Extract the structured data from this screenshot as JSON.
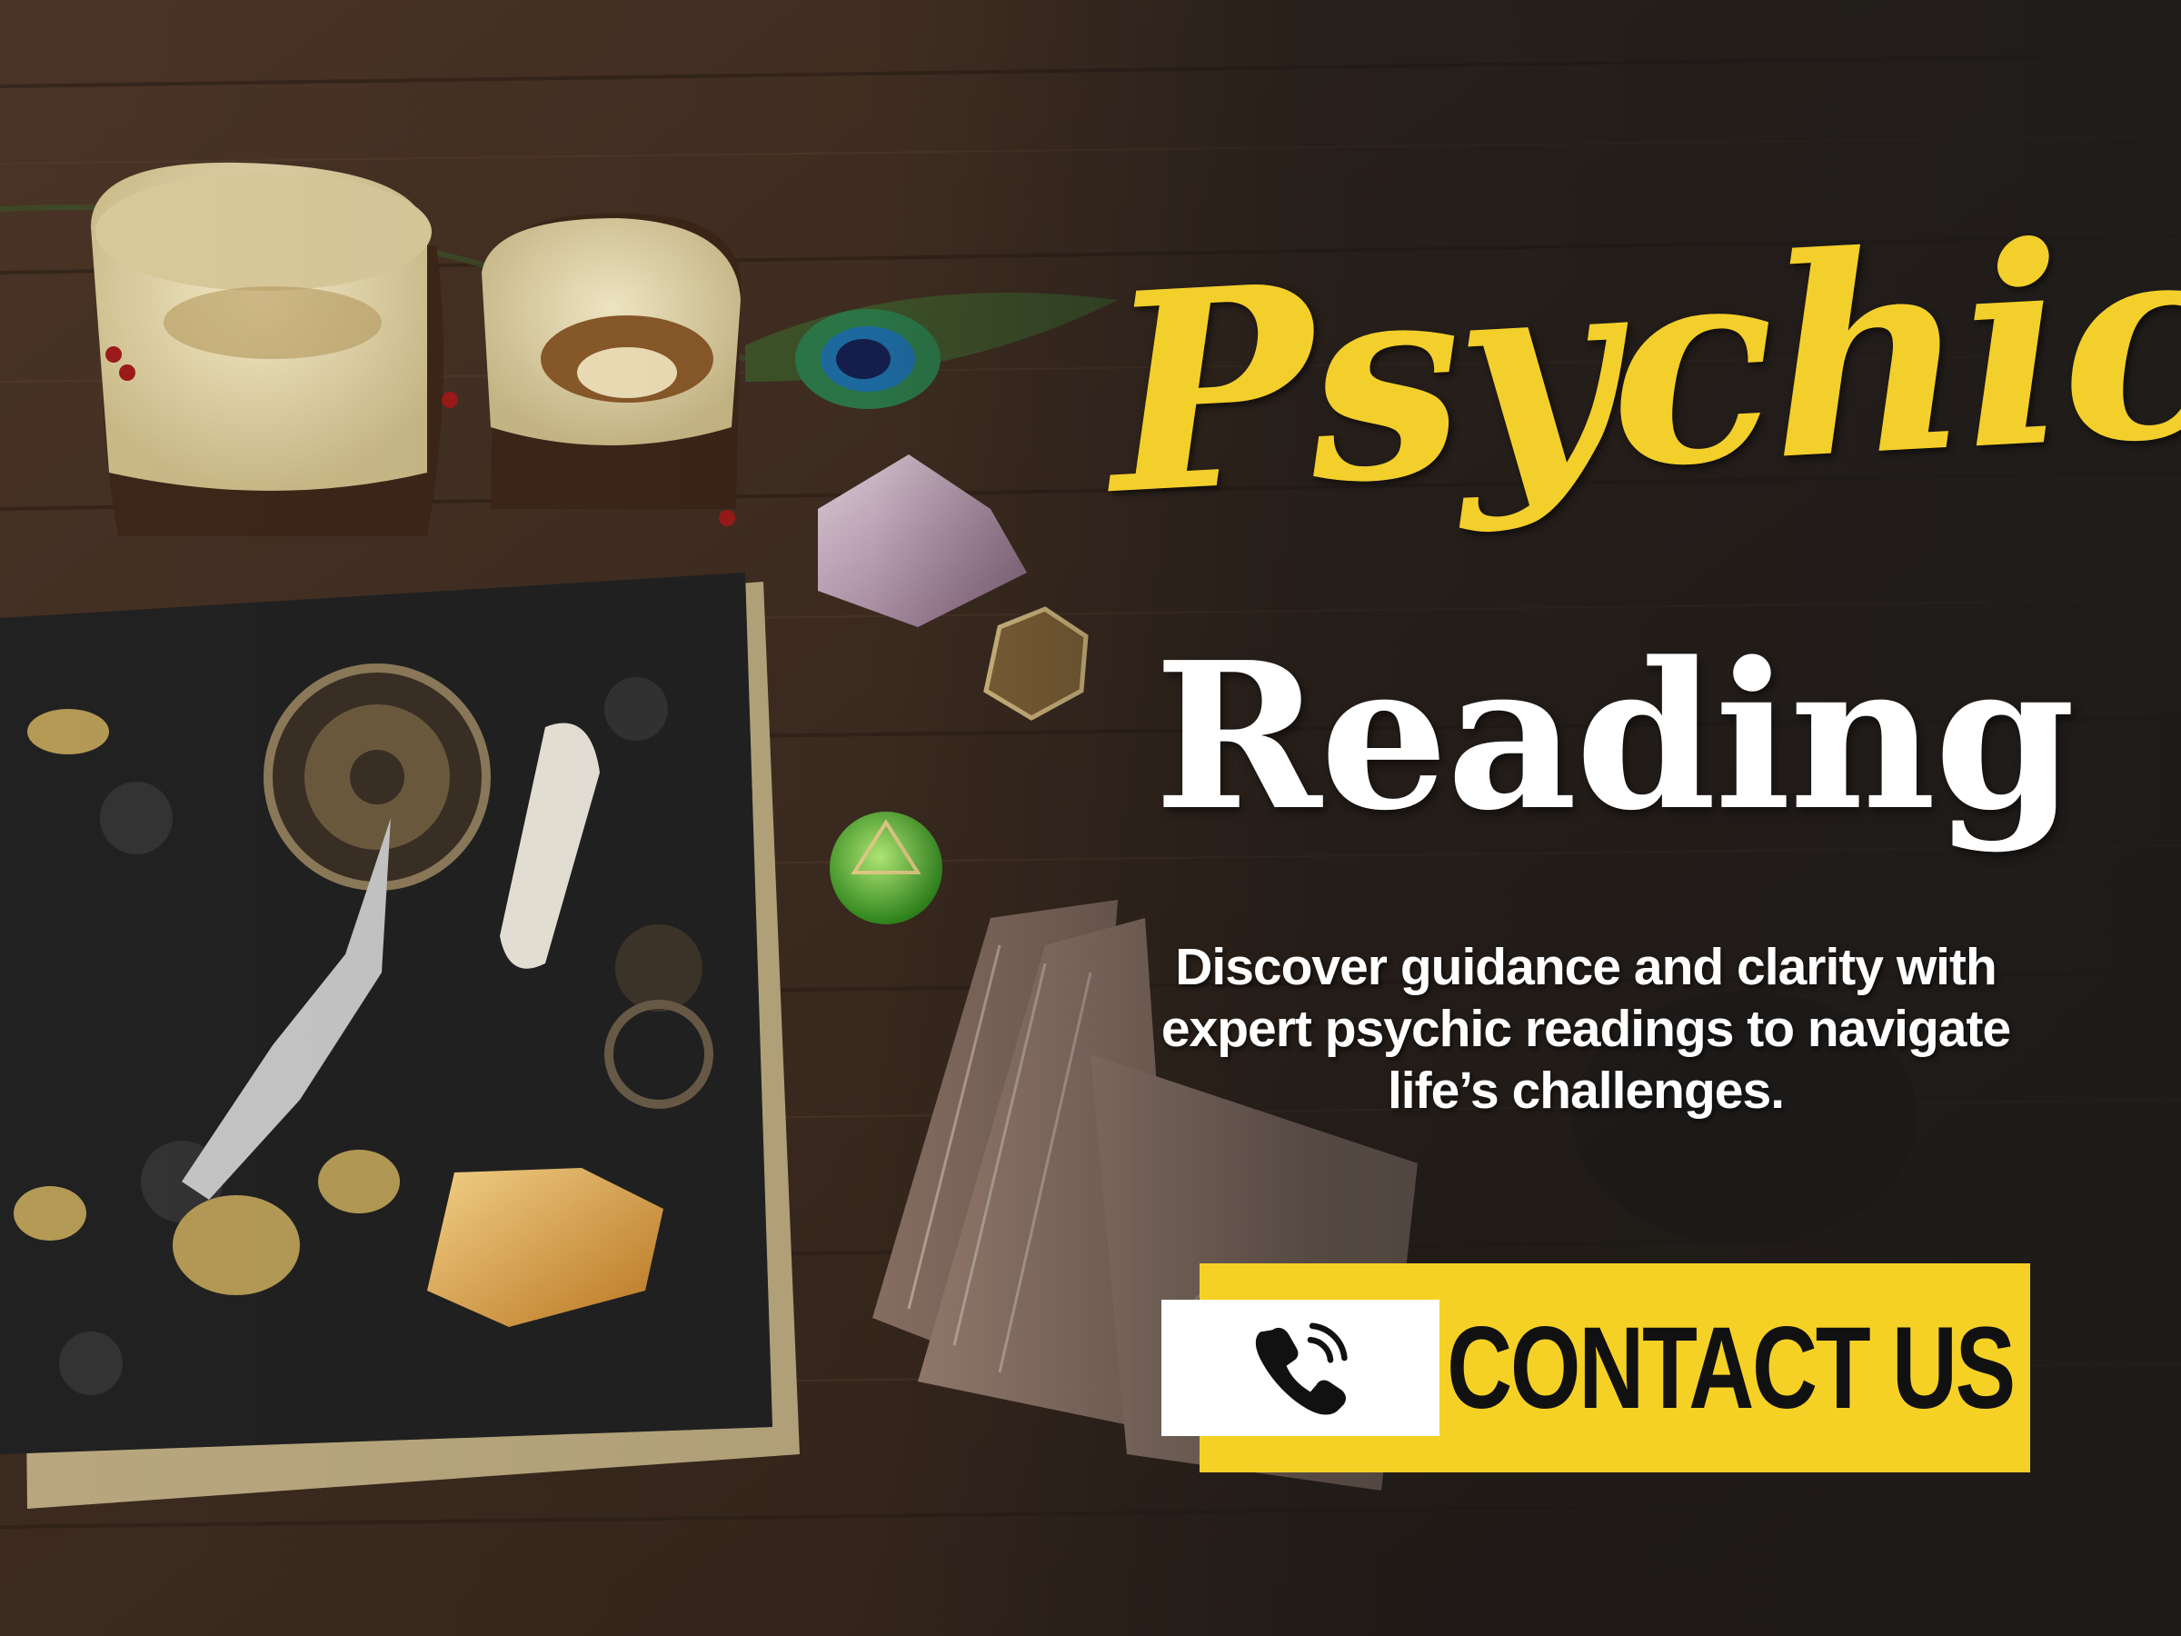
{
  "hero": {
    "headline_script": "Psychic",
    "headline_main": "Reading",
    "description_lines": [
      "Discover guidance and clarity with",
      "expert psychic readings to navigate",
      "life’s challenges."
    ]
  },
  "cta": {
    "label": "CONTACT US",
    "icon": "phone-icon"
  },
  "colors": {
    "accent_yellow": "#f6d125",
    "script_yellow": "#f3cf2b",
    "text_white": "#ffffff",
    "text_dark": "#111111"
  },
  "background_objects": [
    "candle",
    "candle",
    "peacock-feather",
    "amethyst-crystal",
    "gold-dice",
    "spell-book",
    "green-pendant",
    "citrine-crystal",
    "tarot-cards"
  ]
}
